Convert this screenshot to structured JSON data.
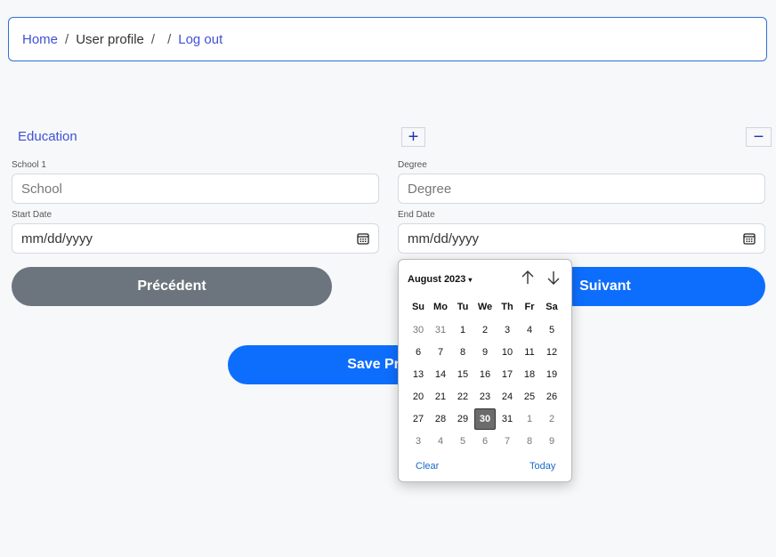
{
  "breadcrumb": {
    "home": "Home",
    "sep1": "/",
    "profile": "User profile",
    "sep2": "/",
    "sep3": "/",
    "logout": "Log out"
  },
  "education": {
    "title": "Education",
    "add_label": "+",
    "remove_label": "−",
    "school_label": "School 1",
    "school_placeholder": "School",
    "degree_label": "Degree",
    "degree_placeholder": "Degree",
    "start_label": "Start Date",
    "start_value": "mm/dd/yyyy",
    "end_label": "End Date",
    "end_value": "mm/dd/yyyy"
  },
  "buttons": {
    "previous": "Précédent",
    "next": "Suivant",
    "save": "Save Profile"
  },
  "datepicker": {
    "month_label": "August 2023",
    "caret": "▾",
    "weekdays": [
      "Su",
      "Mo",
      "Tu",
      "We",
      "Th",
      "Fr",
      "Sa"
    ],
    "weeks": [
      [
        "30",
        "31",
        "1",
        "2",
        "3",
        "4",
        "5"
      ],
      [
        "6",
        "7",
        "8",
        "9",
        "10",
        "11",
        "12"
      ],
      [
        "13",
        "14",
        "15",
        "16",
        "17",
        "18",
        "19"
      ],
      [
        "20",
        "21",
        "22",
        "23",
        "24",
        "25",
        "26"
      ],
      [
        "27",
        "28",
        "29",
        "30",
        "31",
        "1",
        "2"
      ],
      [
        "3",
        "4",
        "5",
        "6",
        "7",
        "8",
        "9"
      ]
    ],
    "clear": "Clear",
    "today": "Today"
  },
  "colors": {
    "accent": "#3f51d6",
    "primary_button": "#0d6efd",
    "secondary_button": "#6c757d",
    "selected_day": "#6c6c6c"
  }
}
